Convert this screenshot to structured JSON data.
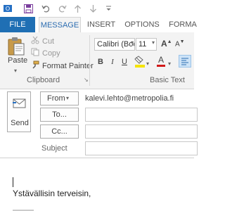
{
  "qat": {
    "save_icon": "save-icon",
    "undo_icon": "undo-icon",
    "redo_icon": "redo-icon",
    "up_icon": "arrow-up-icon",
    "down_icon": "arrow-down-icon",
    "customize_icon": "customize-qat-icon"
  },
  "tabs": {
    "file": "FILE",
    "message": "MESSAGE",
    "insert": "INSERT",
    "options": "OPTIONS",
    "format": "FORMA"
  },
  "clipboard": {
    "paste": "Paste",
    "cut": "Cut",
    "copy": "Copy",
    "format_painter": "Format Painter",
    "label": "Clipboard"
  },
  "basic_text": {
    "font": "Calibri (Boc",
    "size": "11",
    "bold": "B",
    "italic": "I",
    "underline": "U",
    "font_color_glyph": "A",
    "label": "Basic Text",
    "highlight_color": "#f5e400",
    "font_color": "#d11919"
  },
  "header": {
    "send": "Send",
    "from": "From",
    "from_value": "kalevi.lehto@metropolia.fi",
    "to": "To...",
    "cc": "Cc...",
    "subject": "Subject"
  },
  "body": {
    "line1": "Ystävällisin terveisin,"
  },
  "colors": {
    "file_tab": "#1f6fb4",
    "accent": "#2b6cb0"
  }
}
